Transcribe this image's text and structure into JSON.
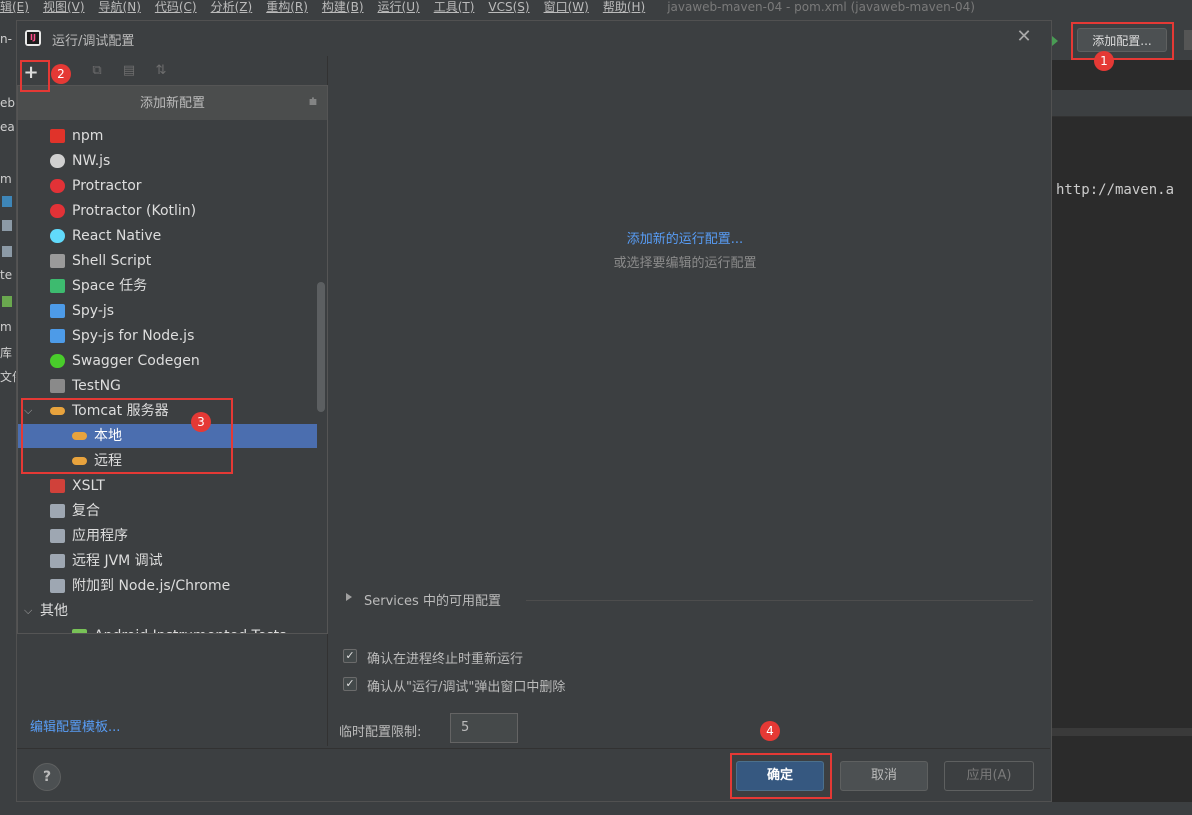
{
  "menubar": {
    "items": [
      "辑(E)",
      "视图(V)",
      "导航(N)",
      "代码(C)",
      "分析(Z)",
      "重构(R)",
      "构建(B)",
      "运行(U)",
      "工具(T)",
      "VCS(S)",
      "窗口(W)",
      "帮助(H)"
    ],
    "title": "javaweb-maven-04 - pom.xml (javaweb-maven-04)"
  },
  "ide": {
    "add_config_label": "添加配置...",
    "editor_code": "http://maven.a",
    "left_fragments": [
      "n-",
      "eb",
      "ea",
      "m",
      "te",
      "m",
      "库",
      "文件"
    ]
  },
  "dialog": {
    "title": "运行/调试配置",
    "title_icon_text": "IJ",
    "close_glyph": "✕",
    "toolbar_plus": "+",
    "popup_header": "添加新配置",
    "popup_items": [
      {
        "label": "npm",
        "icon": "npm-icon",
        "color": "#e0332a"
      },
      {
        "label": "NW.js",
        "icon": "nwjs-icon",
        "color": "#d0d0d0"
      },
      {
        "label": "Protractor",
        "icon": "protractor-icon",
        "color": "#e23237"
      },
      {
        "label": "Protractor (Kotlin)",
        "icon": "protractor-kotlin-icon",
        "color": "#e23237"
      },
      {
        "label": "React Native",
        "icon": "react-icon",
        "color": "#61dafb"
      },
      {
        "label": "Shell Script",
        "icon": "shell-script-icon",
        "color": "#9a9a9a"
      },
      {
        "label": "Space 任务",
        "icon": "space-icon",
        "color": "#3dbb6f"
      },
      {
        "label": "Spy-js",
        "icon": "spyjs-icon",
        "color": "#4d9be8"
      },
      {
        "label": "Spy-js for Node.js",
        "icon": "spyjs-node-icon",
        "color": "#4d9be8"
      },
      {
        "label": "Swagger Codegen",
        "icon": "swagger-icon",
        "color": "#49cc2b"
      },
      {
        "label": "TestNG",
        "icon": "testng-icon",
        "color": "#8a8a8a"
      },
      {
        "label": "Tomcat 服务器",
        "icon": "tomcat-icon",
        "color": "#e8a33d",
        "expanded": true
      },
      {
        "label": "本地",
        "icon": "tomcat-icon",
        "color": "#e8a33d",
        "selected": true
      },
      {
        "label": "远程",
        "icon": "tomcat-icon",
        "color": "#e8a33d"
      },
      {
        "label": "XSLT",
        "icon": "xslt-icon",
        "color": "#d0413a"
      },
      {
        "label": "复合",
        "icon": "compound-icon",
        "color": "#9ea7b2"
      },
      {
        "label": "应用程序",
        "icon": "application-icon",
        "color": "#9ea7b2"
      },
      {
        "label": "远程 JVM 调试",
        "icon": "remote-jvm-icon",
        "color": "#9ea7b2"
      },
      {
        "label": "附加到 Node.js/Chrome",
        "icon": "node-chrome-icon",
        "color": "#9ea7b2"
      },
      {
        "label": "其他",
        "icon": "",
        "color": "",
        "expanded": true
      },
      {
        "label": "Android Instrumented Tests",
        "icon": "android-icon",
        "color": "#78c257"
      }
    ],
    "add_new_link": "添加新的运行配置...",
    "or_select": "或选择要编辑的运行配置",
    "services": "Services 中的可用配置",
    "checkbox_rerun": "确认在进程终止时重新运行",
    "checkbox_delete": "确认从\"运行/调试\"弹出窗口中删除",
    "temp_limit_label": "临时配置限制:",
    "temp_limit_value": "5",
    "edit_templates": "编辑配置模板...",
    "help": "?",
    "ok": "确定",
    "cancel": "取消",
    "apply": "应用(A)"
  },
  "annotations": [
    "1",
    "2",
    "3",
    "4"
  ],
  "colors": {
    "annotation": "#e53935",
    "link": "#589df6",
    "selection": "#4b6eaf"
  }
}
